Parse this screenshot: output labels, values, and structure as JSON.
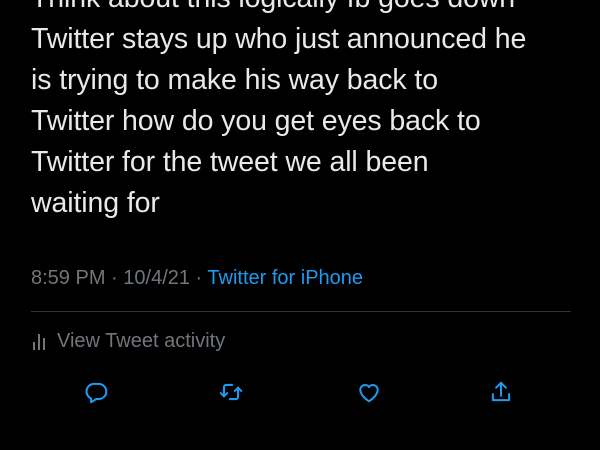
{
  "tweet": {
    "lines": [
      "Think about this logically fb goes down",
      "Twitter stays up who just announced he",
      "is trying to make his way back to",
      "Twitter how do you get eyes back to",
      "Twitter for the tweet we all been",
      "waiting for"
    ],
    "time": "8:59 PM",
    "separator": " · ",
    "date": "10/4/21",
    "source": "Twitter for iPhone"
  },
  "activity": {
    "label": "View Tweet activity",
    "icon": "bar-chart-icon"
  },
  "actions": [
    {
      "name": "reply",
      "icon": "reply-icon"
    },
    {
      "name": "retweet",
      "icon": "retweet-icon"
    },
    {
      "name": "like",
      "icon": "heart-icon"
    },
    {
      "name": "share",
      "icon": "share-icon"
    }
  ],
  "colors": {
    "background": "#000000",
    "text": "#e7e9ea",
    "secondary": "#71767b",
    "link": "#1d9bf0",
    "icon": "#1d9bf0"
  }
}
